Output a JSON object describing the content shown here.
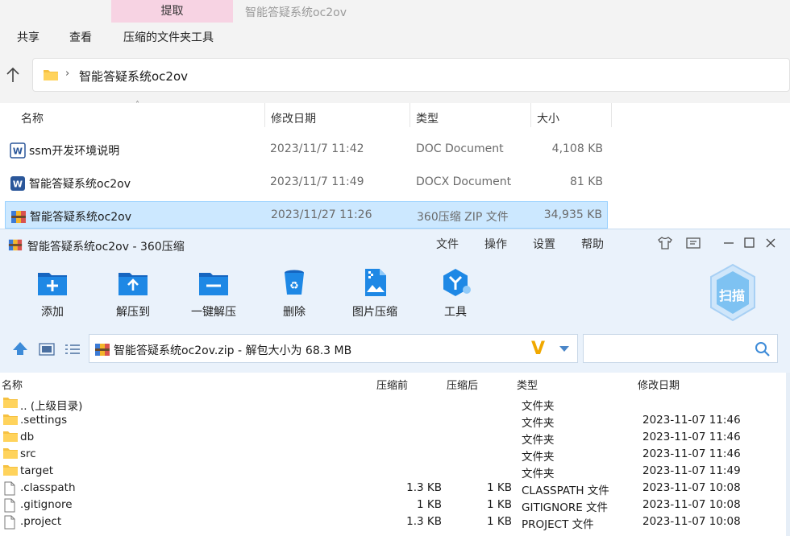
{
  "explorer": {
    "context_tab": "提取",
    "context_title": "智能答疑系统oc2ov",
    "menu": [
      "共享",
      "查看",
      "压缩的文件夹工具"
    ],
    "address": {
      "path": "智能答疑系统oc2ov"
    },
    "columns": {
      "name": "名称",
      "date": "修改日期",
      "type": "类型",
      "size": "大小"
    },
    "files": [
      {
        "icon": "word-doc-icon",
        "name": "ssm开发环境说明",
        "date": "2023/11/7 11:42",
        "type": "DOC Document",
        "size": "4,108 KB",
        "selected": false
      },
      {
        "icon": "word-docx-icon",
        "name": "智能答疑系统oc2ov",
        "date": "2023/11/7 11:49",
        "type": "DOCX Document",
        "size": "81 KB",
        "selected": false
      },
      {
        "icon": "zip-archive-icon",
        "name": "智能答疑系统oc2ov",
        "date": "2023/11/27 11:26",
        "type": "360压缩 ZIP 文件",
        "size": "34,935 KB",
        "selected": true
      }
    ]
  },
  "zip": {
    "title": "智能答疑系统oc2ov - 360压缩",
    "menu": [
      "文件",
      "操作",
      "设置",
      "帮助"
    ],
    "toolbar": [
      "添加",
      "解压到",
      "一键解压",
      "删除",
      "图片压缩",
      "工具"
    ],
    "scan_label": "扫描",
    "path_text": "智能答疑系统oc2ov.zip - 解包大小为 68.3 MB",
    "columns": {
      "name": "名称",
      "before": "压缩前",
      "after": "压缩后",
      "type": "类型",
      "date": "修改日期"
    },
    "rows": [
      {
        "icon": "folder-icon",
        "name": ".. (上级目录)",
        "before": "",
        "after": "",
        "type": "文件夹",
        "date": ""
      },
      {
        "icon": "folder-icon",
        "name": ".settings",
        "before": "",
        "after": "",
        "type": "文件夹",
        "date": "2023-11-07 11:46"
      },
      {
        "icon": "folder-icon",
        "name": "db",
        "before": "",
        "after": "",
        "type": "文件夹",
        "date": "2023-11-07 11:46"
      },
      {
        "icon": "folder-icon",
        "name": "src",
        "before": "",
        "after": "",
        "type": "文件夹",
        "date": "2023-11-07 11:46"
      },
      {
        "icon": "folder-icon",
        "name": "target",
        "before": "",
        "after": "",
        "type": "文件夹",
        "date": "2023-11-07 11:49"
      },
      {
        "icon": "file-icon",
        "name": ".classpath",
        "before": "1.3 KB",
        "after": "1 KB",
        "type": "CLASSPATH 文件",
        "date": "2023-11-07 10:08"
      },
      {
        "icon": "file-icon",
        "name": ".gitignore",
        "before": "1 KB",
        "after": "1 KB",
        "type": "GITIGNORE 文件",
        "date": "2023-11-07 10:08"
      },
      {
        "icon": "file-icon",
        "name": ".project",
        "before": "1.3 KB",
        "after": "1 KB",
        "type": "PROJECT 文件",
        "date": "2023-11-07 10:08"
      }
    ]
  },
  "colors": {
    "accent": "#1e88e5",
    "selection": "#cce8ff",
    "context_tab": "#f7d3e3",
    "zip_bg": "#eaf2fb"
  }
}
